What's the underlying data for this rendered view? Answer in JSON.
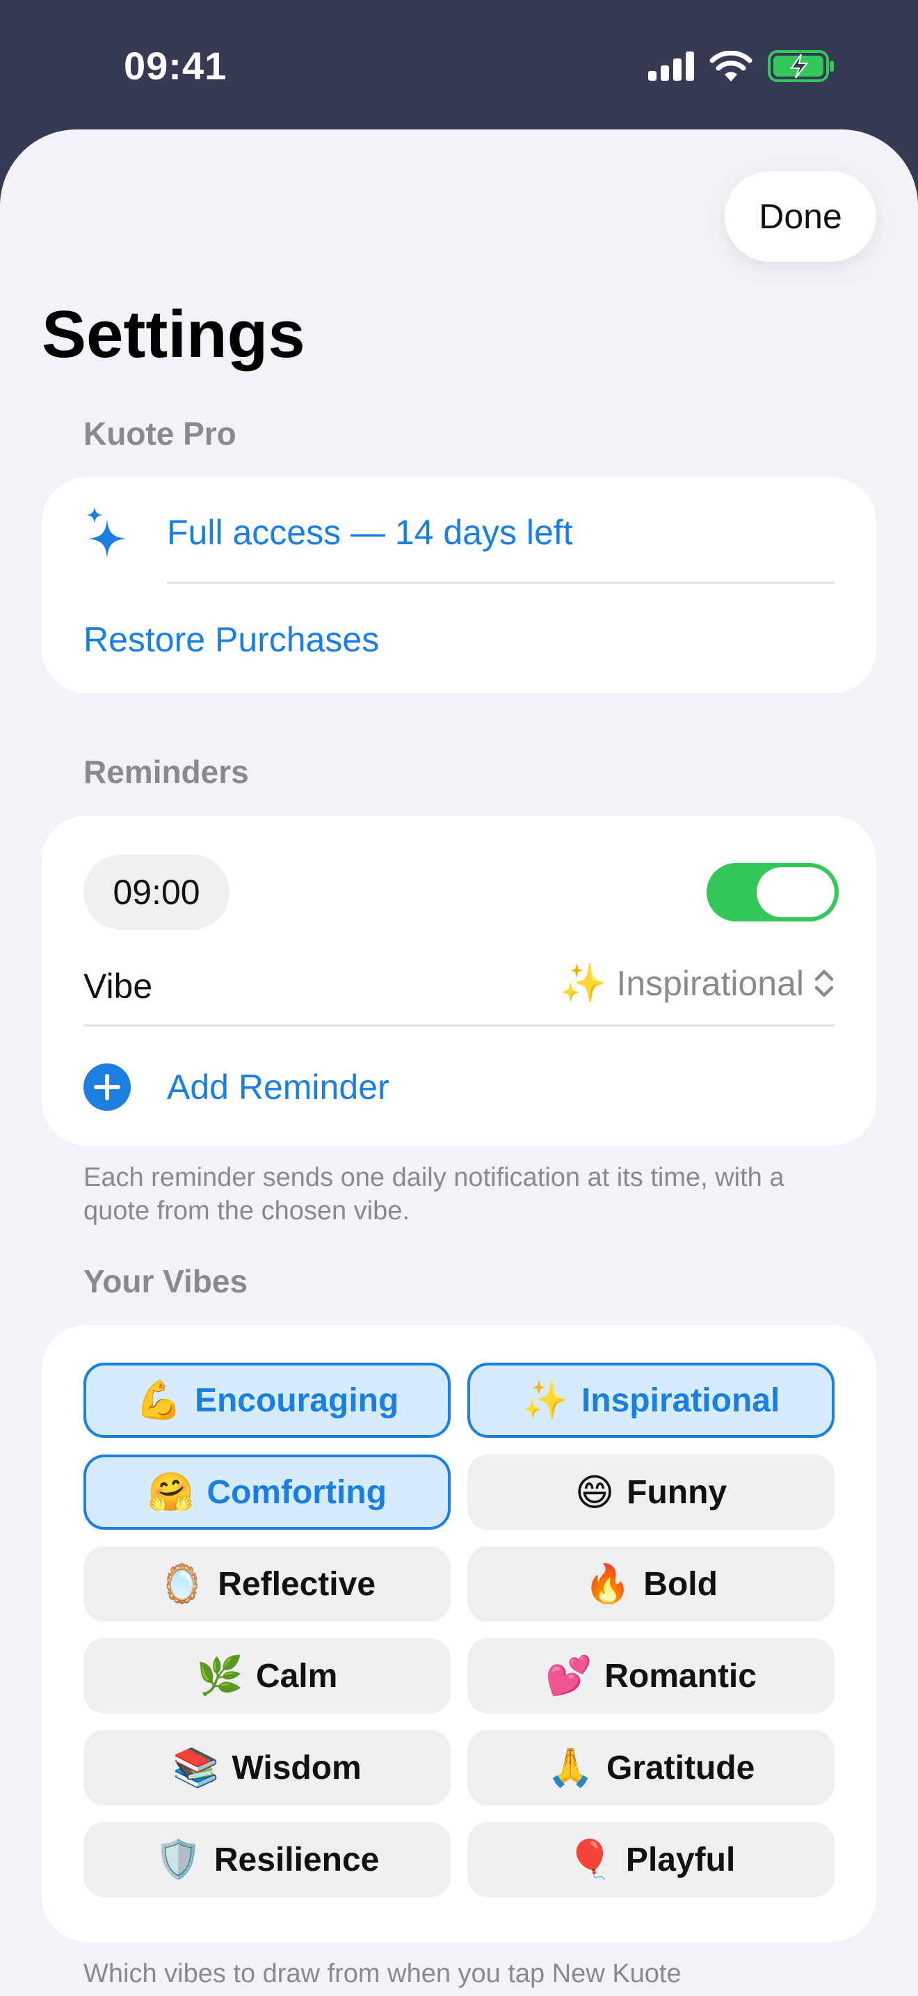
{
  "status": {
    "time": "09:41"
  },
  "header": {
    "done_label": "Done",
    "title": "Settings"
  },
  "pro": {
    "section_title": "Kuote Pro",
    "access_label": "Full access — 14 days left",
    "restore_label": "Restore Purchases"
  },
  "reminders": {
    "section_title": "Reminders",
    "time": "09:00",
    "enabled": true,
    "vibe_label": "Vibe",
    "vibe_emoji": "✨",
    "vibe_value": "Inspirational",
    "add_label": "Add Reminder",
    "footer": "Each reminder sends one daily notification at its time, with a quote from the chosen vibe."
  },
  "vibes": {
    "section_title": "Your Vibes",
    "items": [
      {
        "emoji": "💪",
        "label": "Encouraging",
        "selected": true
      },
      {
        "emoji": "✨",
        "label": "Inspirational",
        "selected": true
      },
      {
        "emoji": "🤗",
        "label": "Comforting",
        "selected": true
      },
      {
        "emoji": "😄",
        "label": "Funny",
        "selected": false
      },
      {
        "emoji": "🪞",
        "label": "Reflective",
        "selected": false
      },
      {
        "emoji": "🔥",
        "label": "Bold",
        "selected": false
      },
      {
        "emoji": "🌿",
        "label": "Calm",
        "selected": false
      },
      {
        "emoji": "💕",
        "label": "Romantic",
        "selected": false
      },
      {
        "emoji": "📚",
        "label": "Wisdom",
        "selected": false
      },
      {
        "emoji": "🙏",
        "label": "Gratitude",
        "selected": false
      },
      {
        "emoji": "🛡️",
        "label": "Resilience",
        "selected": false
      },
      {
        "emoji": "🎈",
        "label": "Playful",
        "selected": false
      }
    ],
    "footer": "Which vibes to draw from when you tap New Kuote"
  },
  "colors": {
    "accent": "#1a7fe0",
    "toggle_on": "#34c759",
    "header_bg": "#363a53"
  }
}
